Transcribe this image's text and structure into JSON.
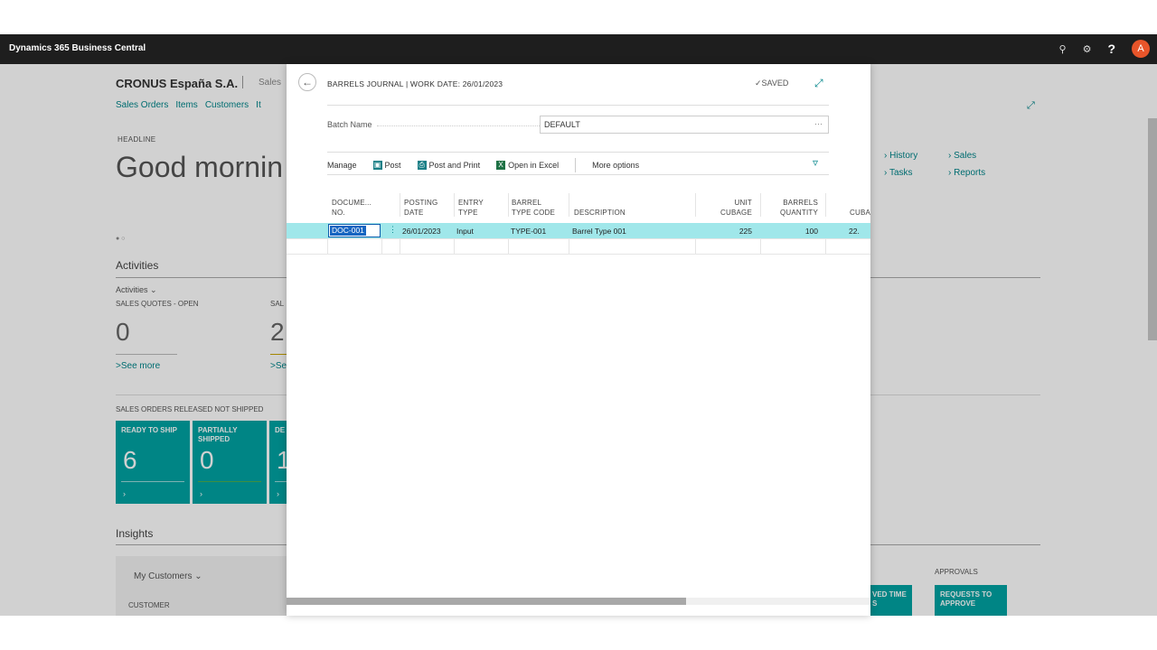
{
  "app": {
    "title": "Dynamics 365 Business Central",
    "avatar_letter": "A"
  },
  "background": {
    "company": "CRONUS España S.A.",
    "company_context": "Sales",
    "nav_links": [
      "Sales Orders",
      "Items",
      "Customers",
      "It"
    ],
    "headline_label": "HEADLINE",
    "greeting": "Good mornin",
    "activities_title": "Activities",
    "activities_sub": "Activities",
    "sales_quotes_label": "SALES QUOTES - OPEN",
    "sales_quotes_value": "0",
    "sales_orders_label": "SAL",
    "sales_orders_value": "2",
    "see_more": "See more",
    "see_more_2": "Se",
    "released_label": "SALES ORDERS RELEASED NOT SHIPPED",
    "tiles": [
      {
        "label": "READY TO SHIP",
        "value": "6"
      },
      {
        "label": "PARTIALLY SHIPPED",
        "value": "0"
      },
      {
        "label": "DE",
        "value": "1"
      }
    ],
    "insights_title": "Insights",
    "my_customers": "My Customers",
    "customer_col": "CUSTOMER",
    "history_link": "History",
    "tasks_link": "Tasks",
    "sales_link": "Sales",
    "reports_link": "Reports",
    "approvals_label": "APPROVALS",
    "requests_tile": "REQUESTS TO APPROVE",
    "ved_tile": "VED TIME S"
  },
  "dialog": {
    "title": "BARRELS JOURNAL | WORK DATE: 26/01/2023",
    "saved": "SAVED",
    "batch_name_label": "Batch Name",
    "batch_name_value": "DEFAULT",
    "actions": {
      "manage": "Manage",
      "post": "Post",
      "post_and_print": "Post and Print",
      "open_in_excel": "Open in Excel",
      "more_options": "More options"
    },
    "columns": {
      "document_no": [
        "DOCUME...",
        "NO."
      ],
      "posting_date": [
        "POSTING",
        "DATE"
      ],
      "entry_type": [
        "ENTRY",
        "TYPE"
      ],
      "barrel_type_code": [
        "BARREL",
        "TYPE CODE"
      ],
      "description": "DESCRIPTION",
      "unit_cubage": [
        "UNIT",
        "CUBAGE"
      ],
      "barrels_quantity": [
        "BARRELS",
        "QUANTITY"
      ],
      "cubage": "CUBA"
    },
    "rows": [
      {
        "document_no": "DOC-001",
        "posting_date": "26/01/2023",
        "entry_type": "Input",
        "barrel_type_code": "TYPE-001",
        "description": "Barrel Type 001",
        "unit_cubage": "225",
        "barrels_quantity": "100",
        "cubage": "22."
      }
    ]
  }
}
